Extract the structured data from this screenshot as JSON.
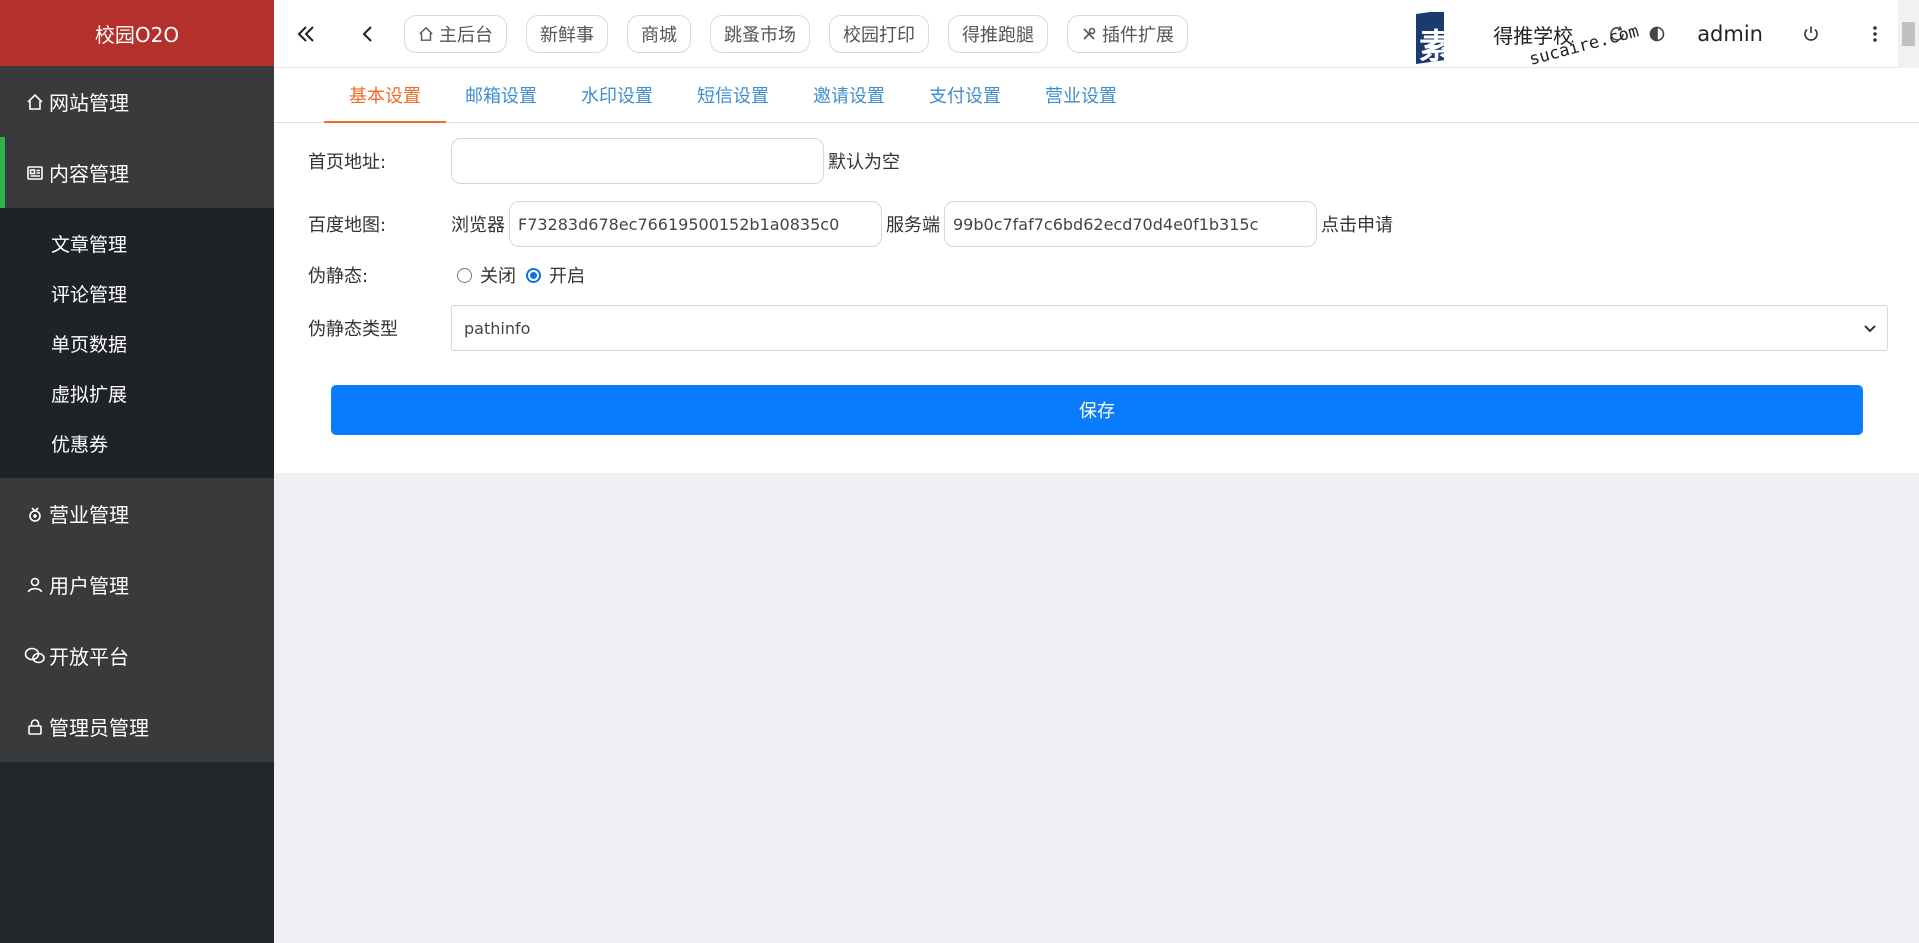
{
  "sidebar": {
    "brand": "校园O2O",
    "menus": [
      {
        "label": "网站管理",
        "icon": "home-icon"
      },
      {
        "label": "内容管理",
        "icon": "content-icon"
      },
      {
        "label": "营业管理",
        "icon": "bag-icon"
      },
      {
        "label": "用户管理",
        "icon": "user-icon"
      },
      {
        "label": "开放平台",
        "icon": "wechat-icon"
      },
      {
        "label": "管理员管理",
        "icon": "lock-icon"
      }
    ],
    "submenu": [
      "文章管理",
      "评论管理",
      "单页数据",
      "虚拟扩展",
      "优惠券"
    ]
  },
  "topbar": {
    "pills": [
      "主后台",
      "新鲜事",
      "商城",
      "跳蚤市场",
      "校园打印",
      "得推跑腿",
      "插件扩展"
    ],
    "school": "得推学校",
    "user": "admin"
  },
  "tabs": [
    "基本设置",
    "邮箱设置",
    "水印设置",
    "短信设置",
    "邀请设置",
    "支付设置",
    "营业设置"
  ],
  "form": {
    "homepage_label": "首页地址:",
    "homepage_value": "",
    "homepage_hint": "默认为空",
    "map_label": "百度地图:",
    "browser_label": "浏览器",
    "browser_key": "F73283d678ec76619500152b1a0835c0",
    "server_label": "服务端",
    "server_key": "99b0c7faf7c6bd62ecd70d4e0f1b315c",
    "apply_link": "点击申请",
    "static_label": "伪静态:",
    "static_off": "关闭",
    "static_on": "开启",
    "static_type_label": "伪静态类型",
    "static_type_value": "pathinfo",
    "save_label": "保存"
  },
  "watermark": {
    "text1": "素材",
    "text2": "sucaire.com"
  },
  "colors": {
    "brand": "#b3302d",
    "accent": "#0a7cfb",
    "active_tab": "#f26a2b",
    "tab": "#3e8ed0"
  }
}
